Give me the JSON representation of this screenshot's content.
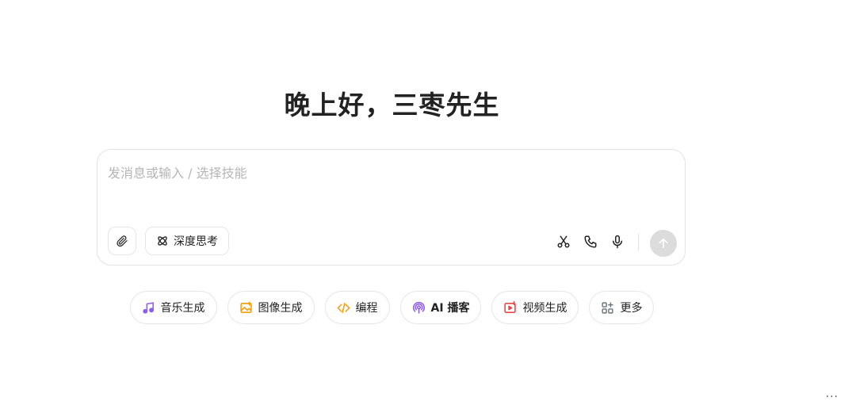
{
  "greeting": "晚上好，三枣先生",
  "composer": {
    "placeholder": "发消息或输入 / 选择技能",
    "deep_think_label": "深度思考"
  },
  "skills": [
    {
      "label": "音乐生成",
      "icon": "music-note-icon",
      "color": "#8b5cf6"
    },
    {
      "label": "图像生成",
      "icon": "image-icon",
      "color": "#f59e0b"
    },
    {
      "label": "编程",
      "icon": "code-icon",
      "color": "#f59e0b"
    },
    {
      "label": "AI 播客",
      "icon": "podcast-icon",
      "color": "#8b5cf6"
    },
    {
      "label": "视频生成",
      "icon": "video-icon",
      "color": "#ef4444"
    },
    {
      "label": "更多",
      "icon": "grid-plus-icon",
      "color": "#6b7280"
    }
  ],
  "corner_menu": "···",
  "colors": {
    "send_disabled": "#dcdcdc",
    "border": "#e2e3e6"
  }
}
